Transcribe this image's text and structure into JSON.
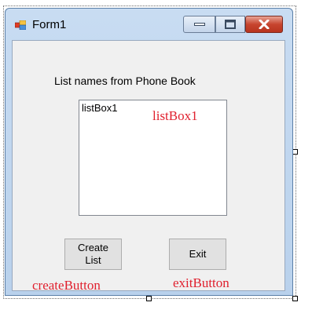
{
  "window": {
    "title": "Form1"
  },
  "form": {
    "label": "List names from Phone Book",
    "listbox_item": "listBox1",
    "create_button": "Create List",
    "exit_button": "Exit"
  },
  "annotations": {
    "listbox": "listBox1",
    "create_button": "createButton",
    "exit_button": "exitButton"
  },
  "colors": {
    "annotation": "#e0202e",
    "close_button": "#c7452f"
  }
}
